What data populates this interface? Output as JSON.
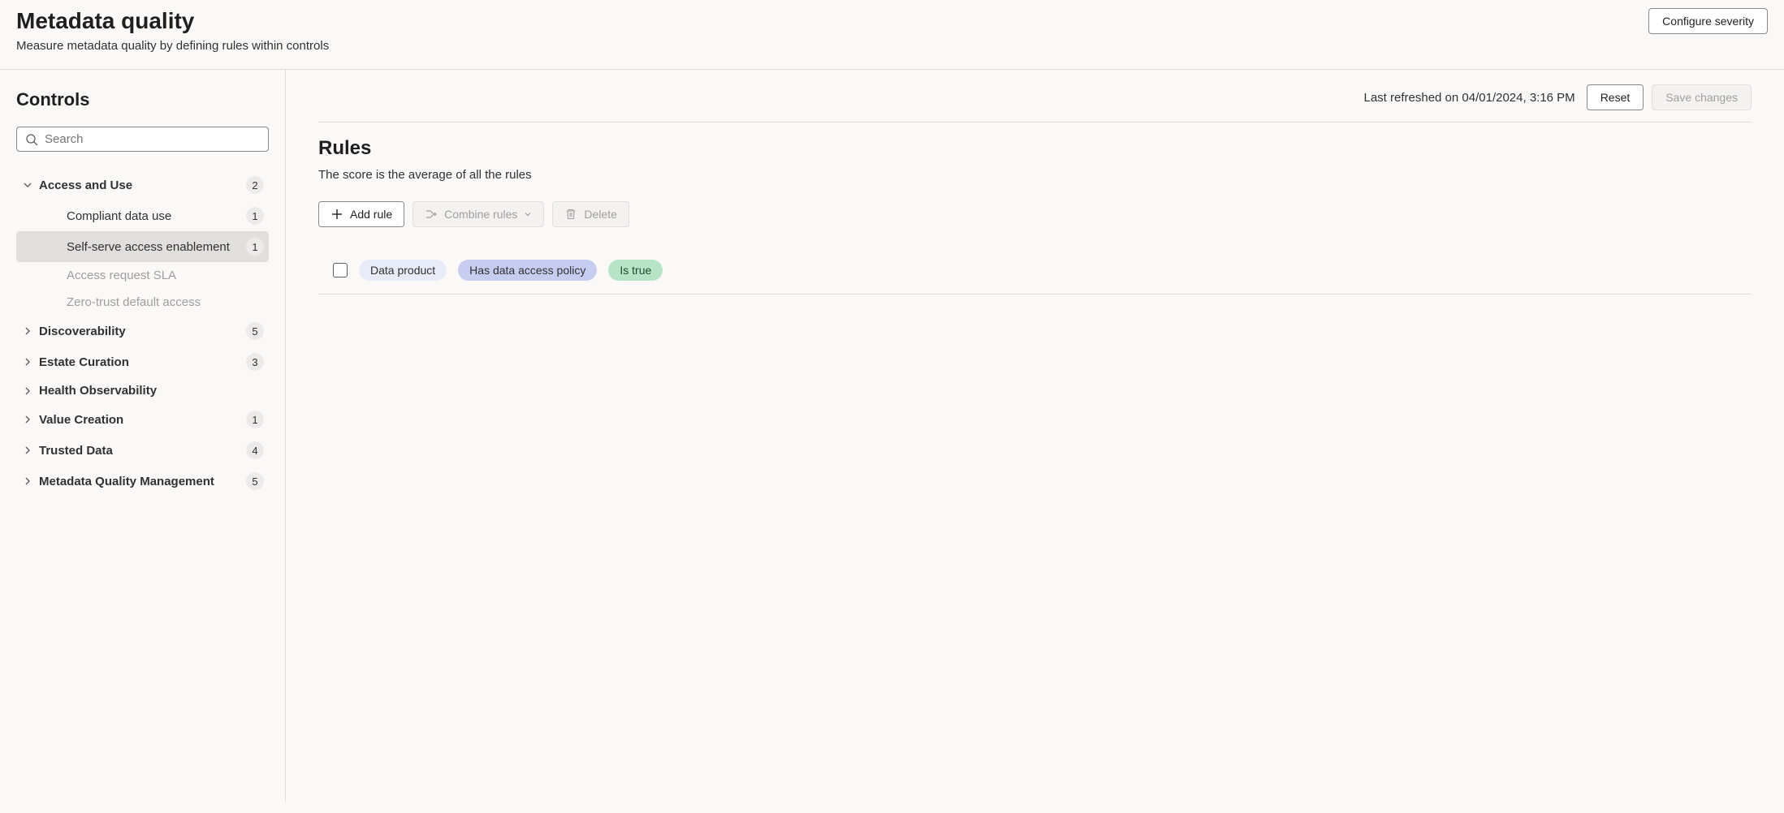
{
  "header": {
    "title": "Metadata quality",
    "subtitle": "Measure metadata quality by defining rules within controls",
    "configure_severity_label": "Configure severity"
  },
  "sidebar": {
    "title": "Controls",
    "search_placeholder": "Search",
    "groups": [
      {
        "label": "Access and Use",
        "count": "2",
        "expanded": true,
        "children": [
          {
            "label": "Compliant data use",
            "count": "1",
            "selected": false,
            "muted": false
          },
          {
            "label": "Self-serve access enablement",
            "count": "1",
            "selected": true,
            "muted": false
          },
          {
            "label": "Access request SLA",
            "count": "",
            "selected": false,
            "muted": true
          },
          {
            "label": "Zero-trust default access",
            "count": "",
            "selected": false,
            "muted": true
          }
        ]
      },
      {
        "label": "Discoverability",
        "count": "5",
        "expanded": false,
        "children": []
      },
      {
        "label": "Estate Curation",
        "count": "3",
        "expanded": false,
        "children": []
      },
      {
        "label": "Health Observability",
        "count": "",
        "expanded": false,
        "children": []
      },
      {
        "label": "Value Creation",
        "count": "1",
        "expanded": false,
        "children": []
      },
      {
        "label": "Trusted Data",
        "count": "4",
        "expanded": false,
        "children": []
      },
      {
        "label": "Metadata Quality Management",
        "count": "5",
        "expanded": false,
        "children": []
      }
    ]
  },
  "topbar": {
    "refreshed_prefix": "Last refreshed on ",
    "refreshed_timestamp": "04/01/2024, 3:16 PM",
    "reset_label": "Reset",
    "save_label": "Save changes"
  },
  "rules": {
    "title": "Rules",
    "description": "The score is the average of all the rules",
    "add_rule_label": "Add rule",
    "combine_rules_label": "Combine rules",
    "delete_label": "Delete",
    "items": [
      {
        "entity": "Data product",
        "condition": "Has data access policy",
        "value": "Is true"
      }
    ]
  }
}
